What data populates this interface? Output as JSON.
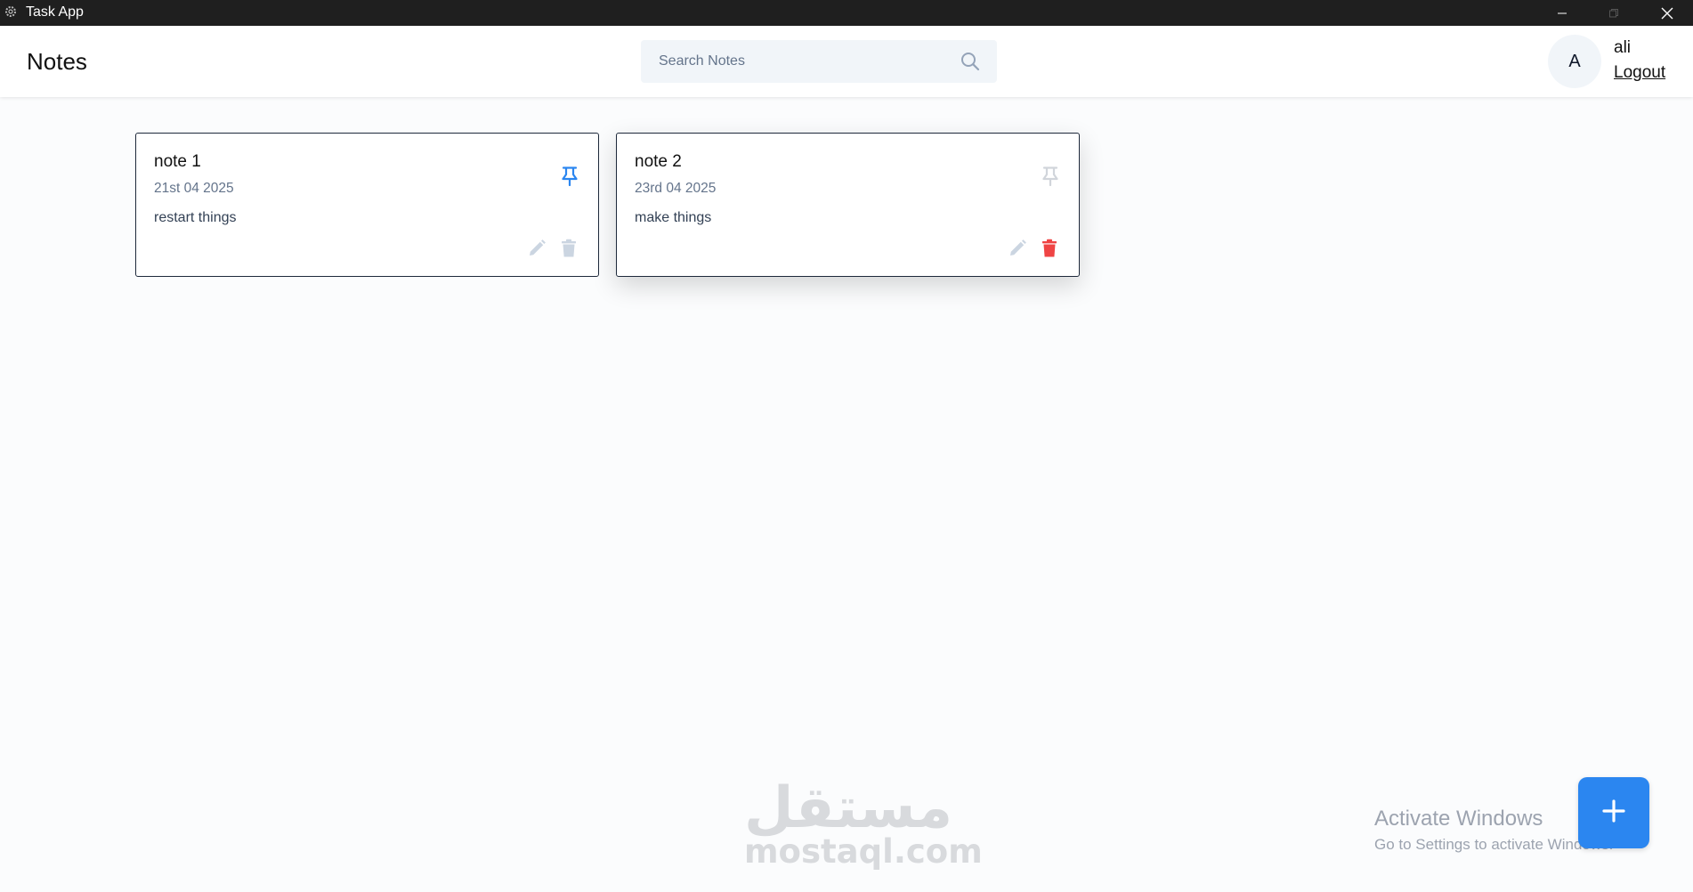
{
  "window": {
    "title": "Task App"
  },
  "header": {
    "title": "Notes",
    "search": {
      "placeholder": "Search Notes",
      "value": ""
    },
    "user": {
      "initial": "A",
      "name": "ali",
      "logout_label": "Logout"
    }
  },
  "notes": [
    {
      "title": "note 1",
      "date": "21st 04 2025",
      "content": "restart things",
      "pinned": true
    },
    {
      "title": "note 2",
      "date": "23rd 04 2025",
      "content": "make things",
      "pinned": false
    }
  ],
  "watermark": {
    "arabic": "مستقل",
    "latin": "mostaql.com"
  },
  "windows_activation": {
    "title": "Activate Windows",
    "subtitle": "Go to Settings to activate Windows."
  },
  "colors": {
    "accent": "#2b86f0",
    "delete_active": "#ef4444",
    "icon_muted": "#cbd5e1",
    "pin_active": "#2b86f0"
  },
  "icons": {
    "app": "gear-icon",
    "search": "search-icon",
    "pin": "pin-icon",
    "edit": "pencil-icon",
    "delete": "trash-icon",
    "add": "plus-icon"
  }
}
